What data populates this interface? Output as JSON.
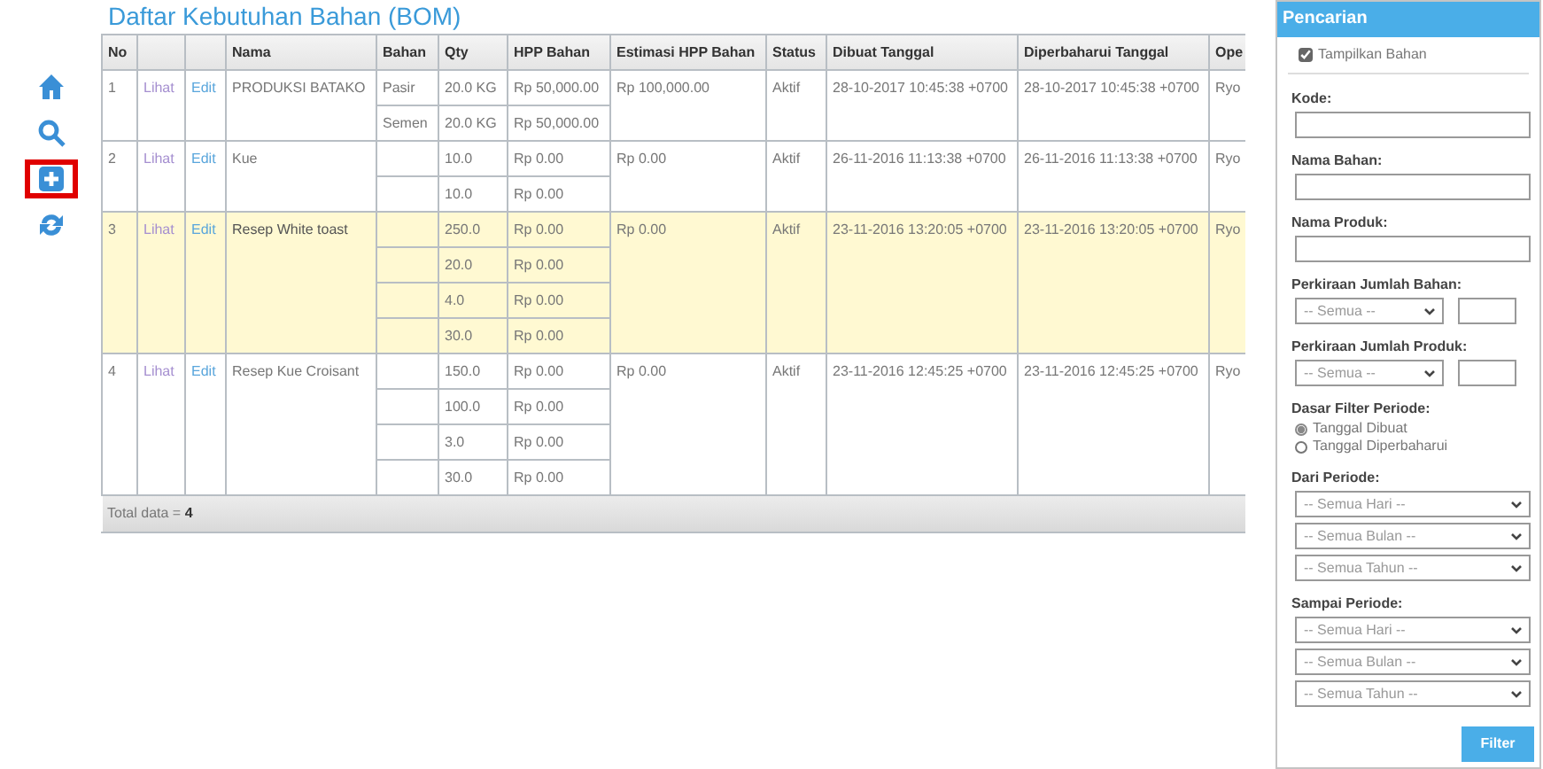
{
  "toolbar": [
    {
      "kind": "home",
      "selected": false
    },
    {
      "kind": "search",
      "selected": false
    },
    {
      "kind": "add",
      "selected": true
    },
    {
      "kind": "refresh",
      "selected": false
    }
  ],
  "title": "Daftar Kebutuhan Bahan (BOM)",
  "table": {
    "columns": [
      "No",
      "",
      "",
      "Nama",
      "Bahan",
      "Qty",
      "HPP Bahan",
      "Estimasi HPP Bahan",
      "Status",
      "Dibuat Tanggal",
      "Diperbaharui Tanggal",
      "Ope"
    ],
    "rows": [
      {
        "no": "1",
        "view": "Lihat",
        "edit": "Edit",
        "name": "PRODUKSI BATAKO",
        "materials": [
          {
            "bahan": "Pasir",
            "qty": "20.0 KG",
            "hpp": "Rp 50,000.00"
          },
          {
            "bahan": "Semen",
            "qty": "20.0 KG",
            "hpp": "Rp 50,000.00"
          }
        ],
        "estimate": "Rp 100,000.00",
        "status": "Aktif",
        "created": "28-10-2017 10:45:38 +0700",
        "updated": "28-10-2017 10:45:38 +0700",
        "operator": "Ryo",
        "selected": false
      },
      {
        "no": "2",
        "view": "Lihat",
        "edit": "Edit",
        "name": "Kue",
        "materials": [
          {
            "qty": "10.0",
            "hpp": "Rp 0.00"
          },
          {
            "qty": "10.0",
            "hpp": "Rp 0.00"
          }
        ],
        "estimate": "Rp 0.00",
        "status": "Aktif",
        "created": "26-11-2016 11:13:38 +0700",
        "updated": "26-11-2016 11:13:38 +0700",
        "operator": "Ryo",
        "selected": false
      },
      {
        "no": "3",
        "view": "Lihat",
        "edit": "Edit",
        "name": "Resep White toast",
        "materials": [
          {
            "qty": "250.0",
            "hpp": "Rp 0.00"
          },
          {
            "qty": "20.0",
            "hpp": "Rp 0.00"
          },
          {
            "qty": "4.0",
            "hpp": "Rp 0.00"
          },
          {
            "qty": "30.0",
            "hpp": "Rp 0.00"
          }
        ],
        "estimate": "Rp 0.00",
        "status": "Aktif",
        "created": "23-11-2016 13:20:05 +0700",
        "updated": "23-11-2016 13:20:05 +0700",
        "operator": "Ryo",
        "selected": true
      },
      {
        "no": "4",
        "view": "Lihat",
        "edit": "Edit",
        "name": "Resep Kue Croisant",
        "materials": [
          {
            "qty": "150.0",
            "hpp": "Rp 0.00"
          },
          {
            "qty": "100.0",
            "hpp": "Rp 0.00"
          },
          {
            "qty": "3.0",
            "hpp": "Rp 0.00"
          },
          {
            "qty": "30.0",
            "hpp": "Rp 0.00"
          }
        ],
        "estimate": "Rp 0.00",
        "status": "Aktif",
        "created": "23-11-2016 12:45:25 +0700",
        "updated": "23-11-2016 12:45:25 +0700",
        "operator": "Ryo",
        "selected": false
      }
    ],
    "footer": "Total data =  **4**"
  },
  "search_panel": {
    "title": "Pencarian",
    "show_materials": {
      "label": "Tampilkan Bahan",
      "checked": true
    },
    "fields": [
      {
        "kind": "text",
        "label": "Kode:"
      },
      {
        "kind": "text",
        "label": "Nama Bahan:"
      },
      {
        "kind": "text",
        "label": "Nama Produk:"
      },
      {
        "kind": "range",
        "label": "Perkiraan Jumlah Bahan:",
        "select": "-- Semua --"
      },
      {
        "kind": "range",
        "label": "Perkiraan Jumlah Produk:",
        "select": "-- Semua --"
      },
      {
        "kind": "radio",
        "label": "Dasar Filter Periode:",
        "options": [
          {
            "label": "Tanggal Dibuat",
            "selected": true
          },
          {
            "label": "Tanggal Diperbaharui",
            "selected": false
          }
        ]
      },
      {
        "kind": "selects",
        "label": "Dari Periode:",
        "selects": [
          "-- Semua Hari --",
          "-- Semua Bulan --",
          "-- Semua Tahun --"
        ]
      },
      {
        "kind": "selects",
        "label": "Sampai Periode:",
        "selects": [
          "-- Semua Hari --",
          "-- Semua Bulan --",
          "-- Semua Tahun --"
        ]
      }
    ],
    "button": "Filter"
  }
}
